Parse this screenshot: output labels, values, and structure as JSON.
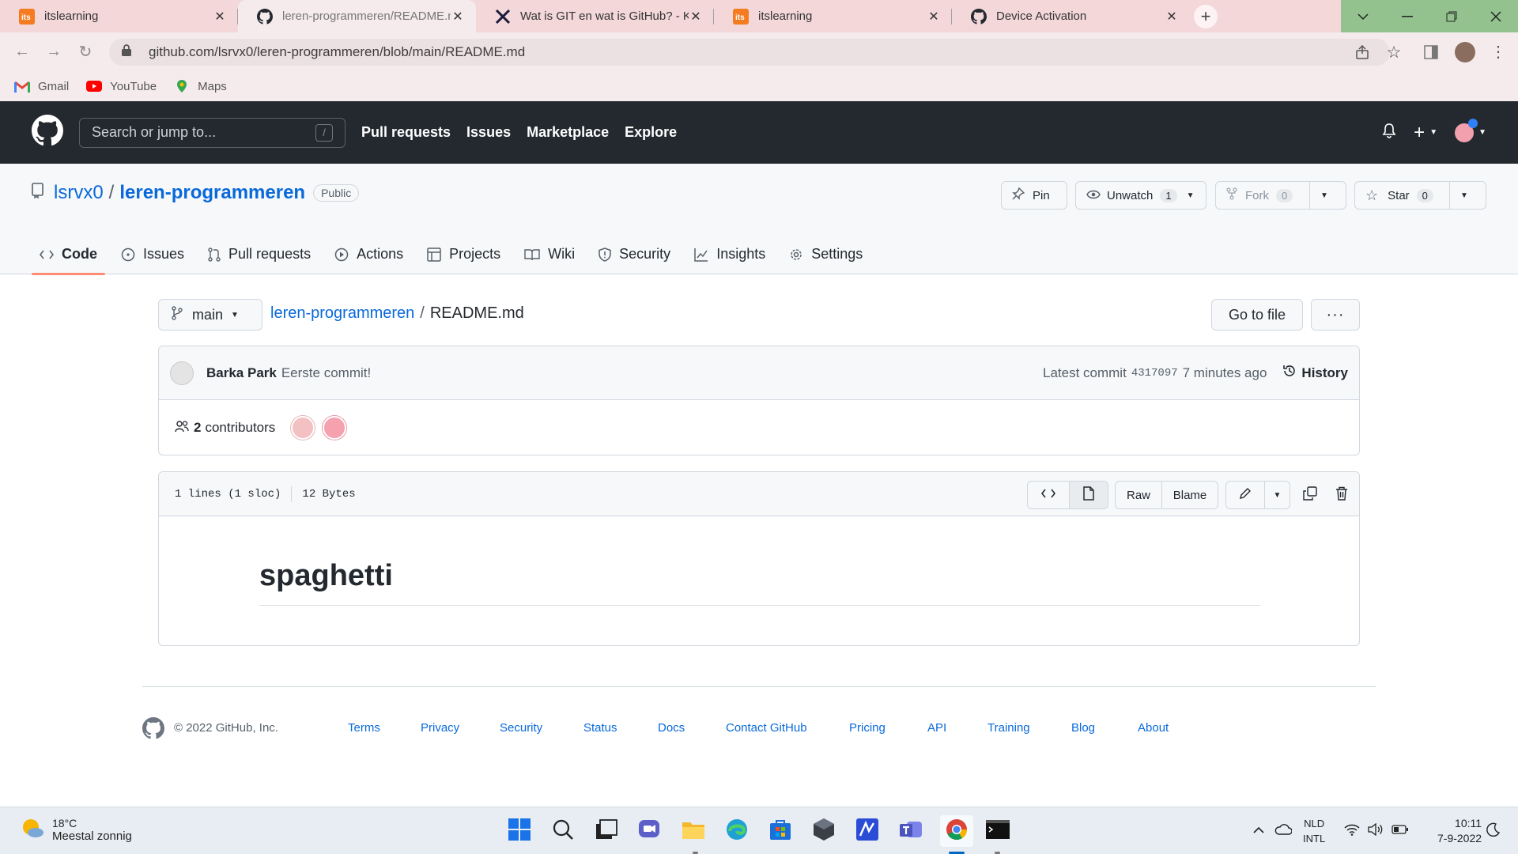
{
  "browser": {
    "tabs": [
      {
        "title": "itslearning",
        "icon": "itslearning-icon",
        "active": false
      },
      {
        "title": "leren-programmeren/README.m",
        "icon": "github-icon",
        "active": true
      },
      {
        "title": "Wat is GIT en wat is GitHub? - Ko",
        "icon": "x-icon",
        "active": false
      },
      {
        "title": "itslearning",
        "icon": "itslearning-icon",
        "active": false
      },
      {
        "title": "Device Activation",
        "icon": "github-icon",
        "active": false
      }
    ],
    "url": "github.com/lsrvx0/leren-programmeren/blob/main/README.md",
    "bookmarks": [
      {
        "label": "Gmail",
        "icon": "gmail-icon"
      },
      {
        "label": "YouTube",
        "icon": "youtube-icon"
      },
      {
        "label": "Maps",
        "icon": "maps-icon"
      }
    ]
  },
  "github": {
    "search_placeholder": "Search or jump to...",
    "search_key": "/",
    "nav": [
      "Pull requests",
      "Issues",
      "Marketplace",
      "Explore"
    ]
  },
  "repo": {
    "owner": "lsrvx0",
    "separator": "/",
    "name": "leren-programmeren",
    "visibility": "Public",
    "pin_label": "Pin",
    "watch_label": "Unwatch",
    "watch_count": "1",
    "fork_label": "Fork",
    "fork_count": "0",
    "star_label": "Star",
    "star_count": "0",
    "tabs": [
      "Code",
      "Issues",
      "Pull requests",
      "Actions",
      "Projects",
      "Wiki",
      "Security",
      "Insights",
      "Settings"
    ]
  },
  "file": {
    "branch": "main",
    "path_repo": "leren-programmeren",
    "path_sep": "/",
    "path_file": "README.md",
    "goto_label": "Go to file",
    "more_label": "···",
    "commit_author": "Barka Park",
    "commit_message": "Eerste commit!",
    "latest_commit_label": "Latest commit",
    "commit_sha": "4317097",
    "commit_time": "7 minutes ago",
    "history_label": "History",
    "contributors_count": "2",
    "contributors_label": "contributors",
    "lines_info": "1 lines (1 sloc)",
    "size_info": "12 Bytes",
    "raw_label": "Raw",
    "blame_label": "Blame",
    "readme_heading": "spaghetti"
  },
  "footer": {
    "copyright": "© 2022 GitHub, Inc.",
    "links": [
      "Terms",
      "Privacy",
      "Security",
      "Status",
      "Docs",
      "Contact GitHub",
      "Pricing",
      "API",
      "Training",
      "Blog",
      "About"
    ]
  },
  "taskbar": {
    "weather_temp": "18°C",
    "weather_desc": "Meestal zonnig",
    "lang_1": "NLD",
    "lang_2": "INTL",
    "time": "10:11",
    "date": "7-9-2022"
  },
  "colors": {
    "github_header": "#24292f",
    "link": "#0969da",
    "tab_underline": "#fd8c73",
    "browser_frame": "#f3d7d9"
  }
}
